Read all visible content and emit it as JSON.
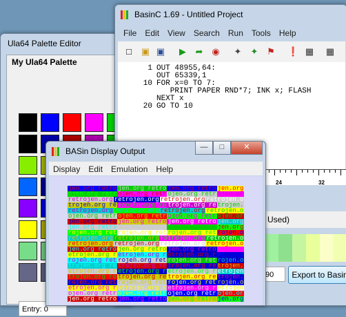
{
  "palette_editor": {
    "title": "Ula64 Palette Editor",
    "panel_title": "My Ula64 Palette",
    "entry_label": "Entry: 0",
    "swatches": [
      [
        "#000000",
        "#0000ff",
        "#ff0000",
        "#ff00ff",
        "#00cc00"
      ],
      [
        "#000000",
        "#0000aa",
        "#aa0000",
        "#aa00aa",
        "#00aa00"
      ],
      [
        "#88ee00",
        "#99aa00",
        "#bbaa00",
        "#aaaa00",
        "#88aa00"
      ],
      [
        "#0066ff",
        "#000088",
        "#880000",
        "#880088",
        "#008800"
      ],
      [
        "#8800ff",
        "#0000cc",
        "#cc0000",
        "#cc00cc",
        "#00cc00"
      ],
      [
        "#ffff00",
        "#999900",
        "#999900",
        "#999900",
        "#999900"
      ],
      [
        "#77dd88",
        "#66bb77",
        "#66bb77",
        "#66bb77",
        "#66bb77"
      ],
      [
        "#666688",
        "#555577",
        "#555577",
        "#555577",
        "#555577"
      ]
    ]
  },
  "basinc": {
    "title": "BasinC 1.69 - Untitled Project",
    "menu": [
      "File",
      "Edit",
      "View",
      "Search",
      "Run",
      "Tools",
      "Help"
    ],
    "toolbar_icons": [
      "new-icon",
      "open-icon",
      "save-icon",
      "run-icon",
      "step-icon",
      "stop-icon",
      "trace-icon",
      "debug-icon",
      "breakpoint-icon",
      "watch-icon",
      "memory-icon"
    ],
    "code": [
      {
        "line": "1",
        "text": "OUT 48955,64:"
      },
      {
        "line": "",
        "text": "OUT 65339,1"
      },
      {
        "line": "10",
        "text": "FOR x=0 TO 7:"
      },
      {
        "line": "",
        "text": "   PRINT PAPER RND*7; INK x; FLASH"
      },
      {
        "line": "",
        "text": "NEXT x"
      },
      {
        "line": "20",
        "text": "GO TO 10"
      }
    ],
    "ruler_labels": [
      "24",
      "32"
    ],
    "used_text": "Used)",
    "field_value": "90",
    "export_button": "Export to Basin"
  },
  "display_output": {
    "title": "BASin Display Output",
    "menu": [
      "Display",
      "Edit",
      "Emulation",
      "Help"
    ],
    "band_text": "retrojen.org"
  },
  "colors": {
    "chrome": "#c6d6e8",
    "desktop": "#6f96b6",
    "spectrum_palette": [
      "#0000cd",
      "#cd0000",
      "#cd00cd",
      "#00cd00",
      "#00cdcd",
      "#cdcd00",
      "#cdcdcd",
      "#0000ff",
      "#ff0000",
      "#ff00ff",
      "#00ff00",
      "#00ffff",
      "#ffff00",
      "#ffffff"
    ]
  }
}
